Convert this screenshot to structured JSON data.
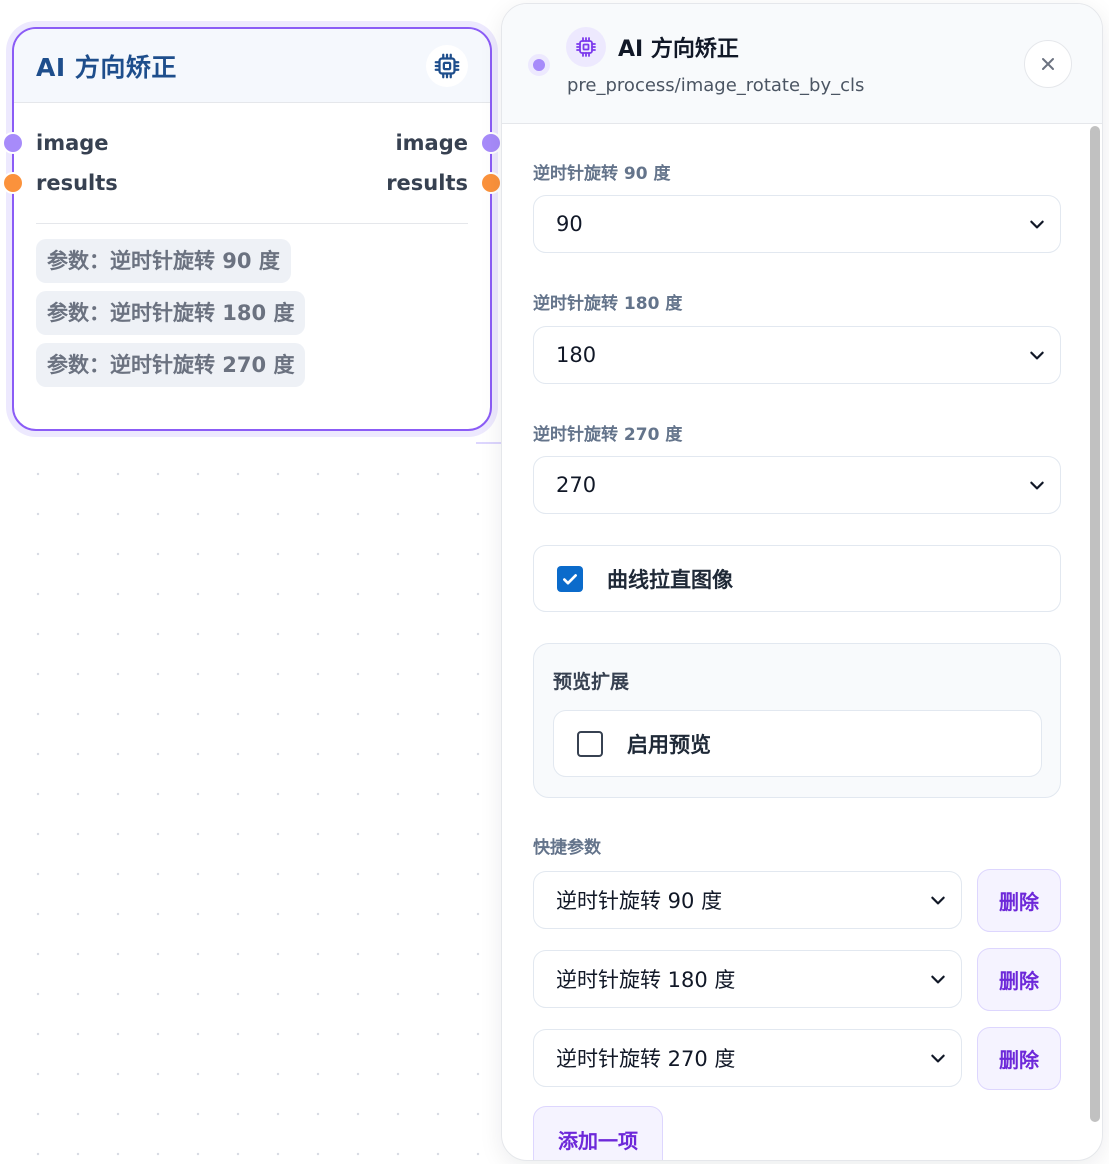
{
  "node": {
    "title": "AI 方向矫正",
    "icon": "cpu-chip-icon",
    "inputs": [
      {
        "label": "image",
        "color": "#a78bfa"
      },
      {
        "label": "results",
        "color": "#fb923c"
      }
    ],
    "outputs": [
      {
        "label": "image",
        "color": "#a78bfa"
      },
      {
        "label": "results",
        "color": "#fb923c"
      }
    ],
    "params": [
      "参数：逆时针旋转 90 度",
      "参数：逆时针旋转 180 度",
      "参数：逆时针旋转 270 度"
    ]
  },
  "panel": {
    "title": "AI 方向矫正",
    "subtitle": "pre_process/image_rotate_by_cls",
    "icon": "cpu-chip-icon",
    "close_icon": "close-icon",
    "fields": [
      {
        "label": "逆时针旋转 90 度",
        "value": "90"
      },
      {
        "label": "逆时针旋转 180 度",
        "value": "180"
      },
      {
        "label": "逆时针旋转 270 度",
        "value": "270"
      }
    ],
    "curve_checkbox": {
      "label": "曲线拉直图像",
      "checked": true
    },
    "preview": {
      "title": "预览扩展",
      "checkbox": {
        "label": "启用预览",
        "checked": false
      }
    },
    "quick": {
      "label": "快捷参数",
      "items": [
        "逆时针旋转 90 度",
        "逆时针旋转 180 度",
        "逆时针旋转 270 度"
      ],
      "delete_label": "删除",
      "add_label": "添加一项"
    }
  },
  "colors": {
    "accent": "#8b5cf6",
    "title_blue": "#1e4e8c",
    "checkbox_blue": "#0b6bcb",
    "port_purple": "#a78bfa",
    "port_orange": "#fb923c"
  }
}
